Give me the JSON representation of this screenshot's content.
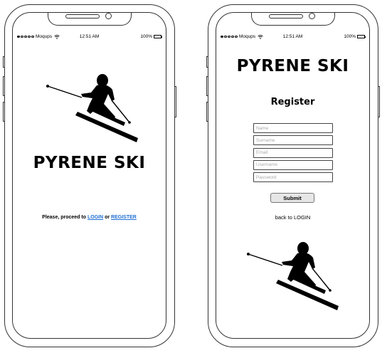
{
  "screens": [
    {
      "status_bar": {
        "carrier": "Moqups",
        "time": "12:51 AM",
        "battery": "100%"
      },
      "brand": "PYRENE SKI",
      "proceed": {
        "prefix": "Please, proceed to ",
        "login_link": "LOGIN",
        "separator": " or ",
        "register_link": "REGISTER"
      },
      "icons": [
        "skier-icon",
        "wifi-icon",
        "battery-icon"
      ]
    },
    {
      "status_bar": {
        "carrier": "Moqups",
        "time": "12:51 AM",
        "battery": "100%"
      },
      "brand": "PYRENE SKI",
      "title": "Register",
      "fields": [
        {
          "placeholder": "Name",
          "value": ""
        },
        {
          "placeholder": "Surname",
          "value": ""
        },
        {
          "placeholder": "Email",
          "value": ""
        },
        {
          "placeholder": "Username",
          "value": ""
        },
        {
          "placeholder": "Password",
          "value": ""
        }
      ],
      "submit_label": "Submit",
      "back_link": "back to LOGIN"
    }
  ],
  "colors": {
    "link": "#1f6fd1",
    "frame": "#333333",
    "button_bg": "#e6e6e6"
  }
}
